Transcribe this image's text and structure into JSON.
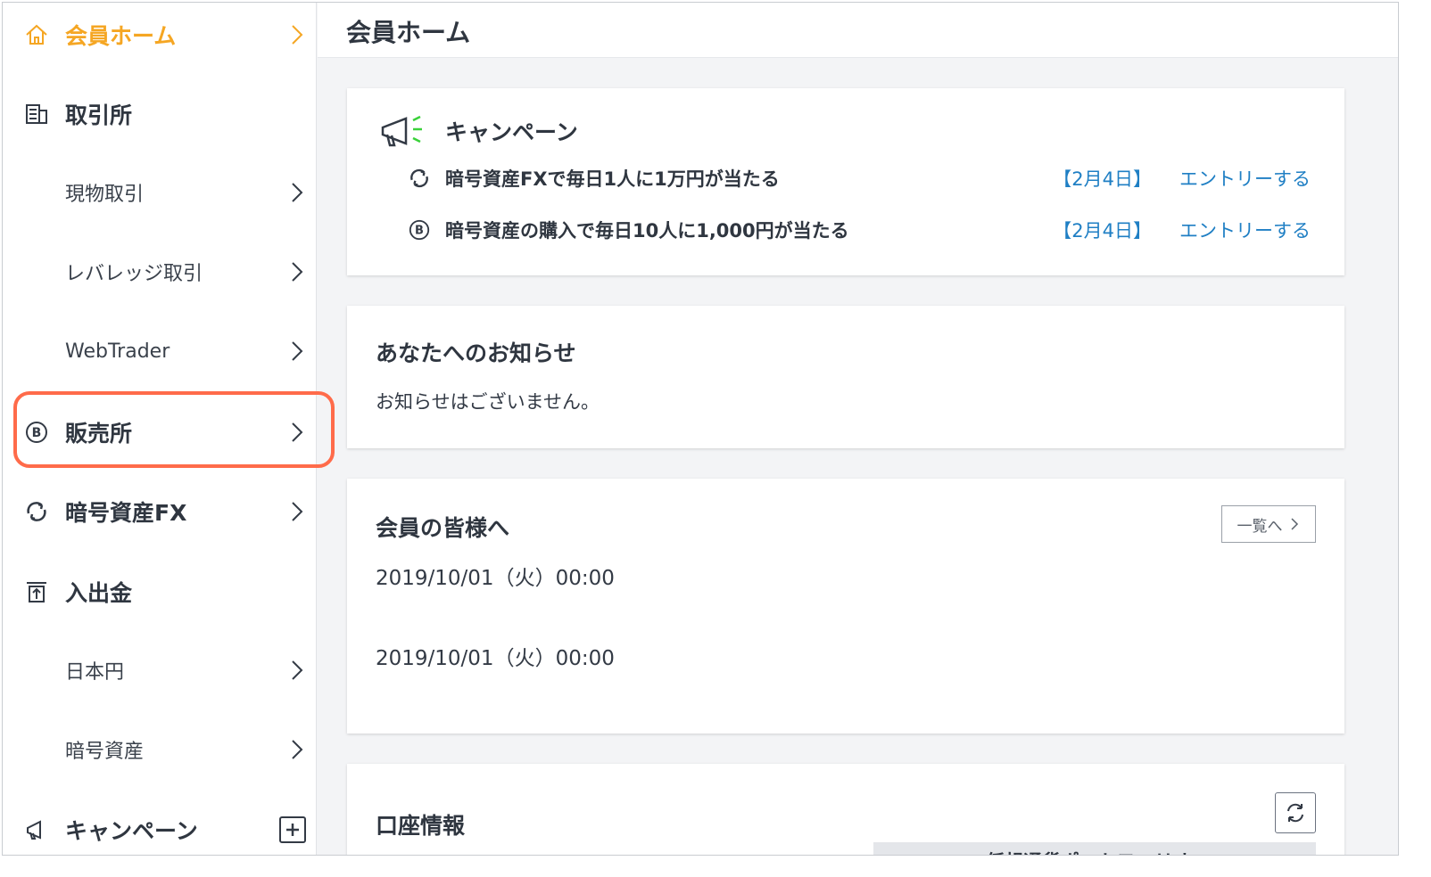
{
  "sidebar": {
    "items": [
      {
        "label": "会員ホーム",
        "icon": "home-icon",
        "active": true
      },
      {
        "label": "取引所",
        "icon": "building-icon"
      },
      {
        "label": "現物取引"
      },
      {
        "label": "レバレッジ取引"
      },
      {
        "label": "WebTrader"
      },
      {
        "label": "販売所",
        "icon": "bitcoin-icon"
      },
      {
        "label": "暗号資産FX",
        "icon": "exchange-icon"
      },
      {
        "label": "入出金",
        "icon": "deposit-icon"
      },
      {
        "label": "日本円"
      },
      {
        "label": "暗号資産"
      },
      {
        "label": "キャンペーン",
        "icon": "megaphone-icon"
      }
    ],
    "active_color": "#f5a623",
    "highlight_color": "#ff6b4a"
  },
  "header": {
    "title": "会員ホーム"
  },
  "campaign": {
    "title": "キャンペーン",
    "rows": [
      {
        "text": "暗号資産FXで毎日1人に1万円が当たる",
        "date": "【2月4日】",
        "entry": "エントリーする",
        "icon": "exchange-icon"
      },
      {
        "text": "暗号資産の購入で毎日10人に1,000円が当たる",
        "date": "【2月4日】",
        "entry": "エントリーする",
        "icon": "bitcoin-icon"
      }
    ]
  },
  "notice": {
    "title": "あなたへのお知らせ",
    "body": "お知らせはございません。"
  },
  "members": {
    "title": "会員の皆様へ",
    "list_button": "一覧へ",
    "entries": [
      "2019/10/01（火）00:00",
      "2019/10/01（火）00:00"
    ]
  },
  "account": {
    "title": "口座情報",
    "portfolio_tab": "仮想通貨ポートフォリオ"
  },
  "colors": {
    "link": "#1f7fc4",
    "text": "#2f3640"
  }
}
